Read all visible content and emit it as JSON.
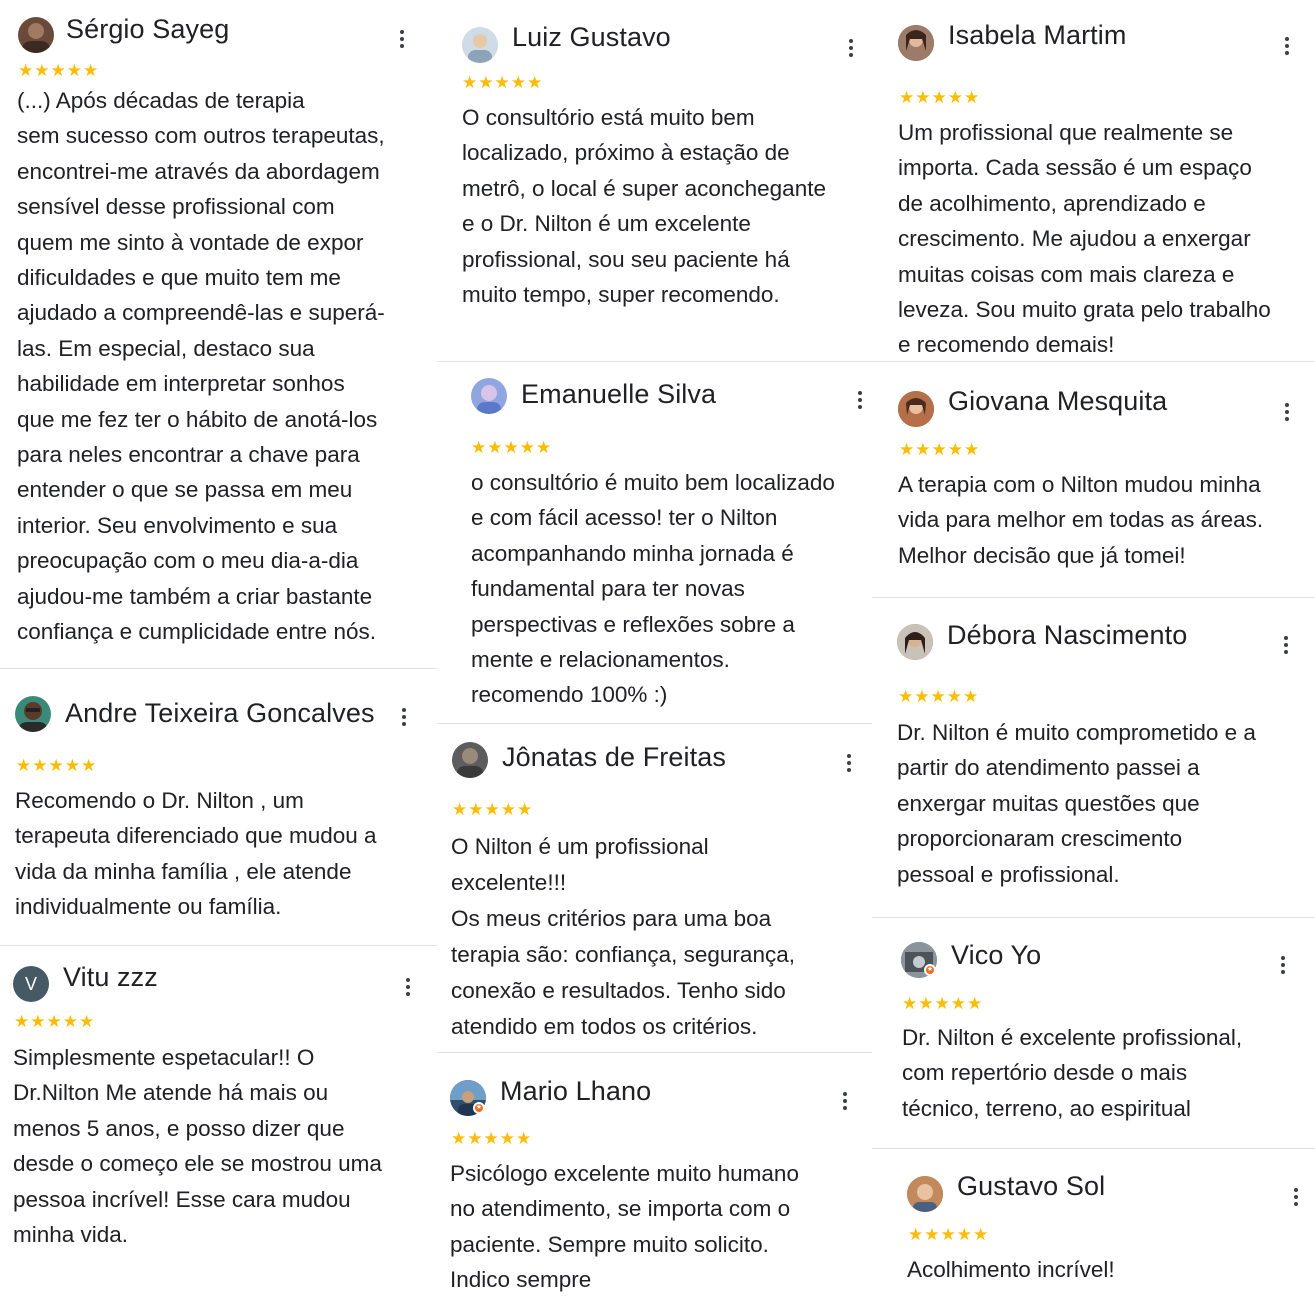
{
  "reviews": [
    {
      "name": "Sérgio Sayeg",
      "stars": "★★★★★",
      "text": "(...)  Após décadas de terapia\nsem sucesso com outros terapeutas,\nencontrei-me através da abordagem\nsensível desse profissional com\nquem me sinto à vontade de expor\ndificuldades e que muito tem me\najudado a compreendê-las e superá-\nlas. Em especial, destaco sua\nhabilidade em interpretar sonhos\nque me fez ter o hábito de anotá-los\npara neles encontrar a chave para\nentender o que se passa em meu\ninterior. Seu envolvimento e sua\npreocupação com o meu dia-a-dia\najudou-me também a criar bastante\nconfiança e cumplicidade entre nós.",
      "avatar_color": "#6b4a3a"
    },
    {
      "name": "Andre Teixeira Goncalves",
      "stars": "★★★★★",
      "text": "Recomendo o Dr. Nilton , um\nterapeuta diferenciado que mudou a\nvida da minha família , ele atende\nindividualmente ou família.",
      "avatar_color": "#3a8a7a"
    },
    {
      "name": "Vitu zzz",
      "stars": "★★★★★",
      "text": "Simplesmente espetacular!! O\nDr.Nilton Me atende há mais ou\nmenos 5 anos, e posso dizer que\ndesde o começo ele se mostrou uma\npessoa incrível! Esse cara mudou\nminha vida.",
      "avatar_letter": "V",
      "avatar_color": "#455a64"
    },
    {
      "name": "Luiz Gustavo",
      "stars": "★★★★★",
      "text": "O consultório está muito bem\nlocalizado, próximo à estação de\nmetrô, o local é super aconchegante\ne o Dr. Nilton é um excelente\nprofissional, sou seu paciente há\nmuito tempo, super recomendo.",
      "avatar_color": "#9fb3c8"
    },
    {
      "name": "Emanuelle Silva",
      "stars": "★★★★★",
      "text": "o consultório é muito bem localizado\ne com fácil acesso! ter o Nilton\nacompanhando minha jornada é\nfundamental para ter novas\nperspectivas e reflexões sobre a\nmente e relacionamentos.\nrecomendo 100% :)",
      "avatar_color": "#8fa6e0"
    },
    {
      "name": "Jônatas de Freitas",
      "stars": "★★★★★",
      "text": "O Nilton é um profissional\nexcelente!!!\nOs meus critérios para uma boa\nterapia são: confiança, segurança,\nconexão e resultados. Tenho sido\natendido em todos os critérios.",
      "avatar_color": "#5d5d5d"
    },
    {
      "name": "Mario Lhano",
      "stars": "★★★★★",
      "text": "Psicólogo excelente muito humano\nno atendimento, se importa com o\npaciente. Sempre muito solicito.\nIndico sempre",
      "avatar_color": "#2f4f6f"
    },
    {
      "name": "Isabela Martim",
      "stars": "★★★★★",
      "text": "Um profissional que realmente se\nimporta. Cada sessão é um espaço\nde acolhimento, aprendizado e\ncrescimento. Me ajudou a enxergar\nmuitas coisas com mais clareza e\nleveza. Sou muito grata pelo trabalho\ne recomendo demais!",
      "avatar_color": "#7a5c4a"
    },
    {
      "name": "Giovana Mesquita",
      "stars": "★★★★★",
      "text": "A terapia com o Nilton mudou minha\nvida para melhor em todas as áreas.\nMelhor decisão que já tomei!",
      "avatar_color": "#a0522d"
    },
    {
      "name": "Débora Nascimento",
      "stars": "★★★★★",
      "text": "Dr. Nilton é muito comprometido e a\npartir do atendimento passei a\nenxergar muitas questões que\nproporcionaram crescimento\npessoal e profissional.",
      "avatar_color": "#8a7060"
    },
    {
      "name": "Vico Yo",
      "stars": "★★★★★",
      "text": "Dr. Nilton é excelente profissional,\ncom repertório desde o mais\ntécnico, terreno, ao espiritual",
      "avatar_color": "#6f7a80"
    },
    {
      "name": "Gustavo Sol",
      "stars": "★★★★★",
      "text": "Acolhimento incrível!",
      "avatar_color": "#b07a50"
    }
  ],
  "colors": {
    "star": "#fbbc04",
    "text": "#202124",
    "divider": "#e3e3e3",
    "local_guide_badge": "#f26b1d"
  },
  "icons": {
    "menu": "more-vert-icon",
    "stars": "star-icon",
    "local_guide": "local-guide-badge-icon"
  }
}
